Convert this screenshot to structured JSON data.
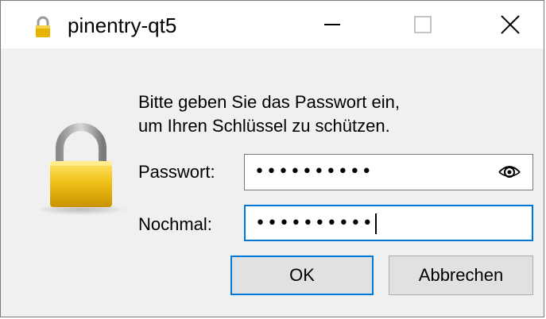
{
  "window": {
    "title": "pinentry-qt5",
    "controls": {
      "minimize": "minimize",
      "maximize": "maximize",
      "close": "close"
    }
  },
  "dialog": {
    "intro_line1": "Bitte geben Sie das Passwort ein,",
    "intro_line2": "um Ihren Schlüssel zu schützen.",
    "password_label": "Passwort:",
    "password_value": "••••••••••",
    "repeat_label": "Nochmal:",
    "repeat_value": "••••••••••"
  },
  "buttons": {
    "ok": "OK",
    "cancel": "Abbrechen"
  },
  "colors": {
    "accent": "#0078d7",
    "lock_gold": "#e8b400"
  },
  "icons": {
    "title": "lock-icon",
    "main": "padlock-icon",
    "reveal": "eye-icon"
  }
}
